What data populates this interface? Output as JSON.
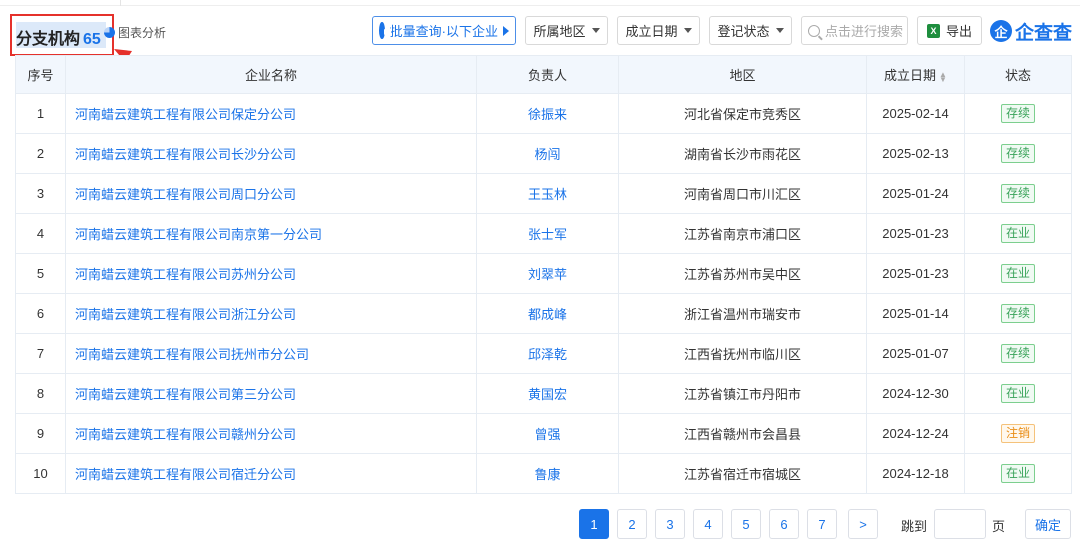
{
  "header": {
    "title": "分支机构",
    "count": "65",
    "chart_link": "图表分析",
    "batch_query": "批量查询·以下企业",
    "filters": {
      "region": "所属地区",
      "founded": "成立日期",
      "status": "登记状态"
    },
    "search_placeholder": "点击进行搜索",
    "export_label": "导出",
    "logo_text": "企查查",
    "logo_mark": "企"
  },
  "table": {
    "columns": [
      "序号",
      "企业名称",
      "负责人",
      "地区",
      "成立日期",
      "状态"
    ],
    "rows": [
      [
        "1",
        "河南蜡云建筑工程有限公司保定分公司",
        "徐振来",
        "河北省保定市竞秀区",
        "2025-02-14",
        "存续"
      ],
      [
        "2",
        "河南蜡云建筑工程有限公司长沙分公司",
        "杨闯",
        "湖南省长沙市雨花区",
        "2025-02-13",
        "存续"
      ],
      [
        "3",
        "河南蜡云建筑工程有限公司周口分公司",
        "王玉林",
        "河南省周口市川汇区",
        "2025-01-24",
        "存续"
      ],
      [
        "4",
        "河南蜡云建筑工程有限公司南京第一分公司",
        "张士军",
        "江苏省南京市浦口区",
        "2025-01-23",
        "在业"
      ],
      [
        "5",
        "河南蜡云建筑工程有限公司苏州分公司",
        "刘翠苹",
        "江苏省苏州市吴中区",
        "2025-01-23",
        "在业"
      ],
      [
        "6",
        "河南蜡云建筑工程有限公司浙江分公司",
        "都成峰",
        "浙江省温州市瑞安市",
        "2025-01-14",
        "存续"
      ],
      [
        "7",
        "河南蜡云建筑工程有限公司抚州市分公司",
        "邱泽乾",
        "江西省抚州市临川区",
        "2025-01-07",
        "存续"
      ],
      [
        "8",
        "河南蜡云建筑工程有限公司第三分公司",
        "黄国宏",
        "江苏省镇江市丹阳市",
        "2024-12-30",
        "在业"
      ],
      [
        "9",
        "河南蜡云建筑工程有限公司赣州分公司",
        "曾强",
        "江西省赣州市会昌县",
        "2024-12-24",
        "注销"
      ],
      [
        "10",
        "河南蜡云建筑工程有限公司宿迁分公司",
        "鲁康",
        "江苏省宿迁市宿城区",
        "2024-12-18",
        "在业"
      ]
    ]
  },
  "pagination": {
    "pages": [
      "1",
      "2",
      "3",
      "4",
      "5",
      "6",
      "7"
    ],
    "current": "1",
    "next": ">",
    "jump_label": "跳到",
    "page_unit": "页",
    "confirm": "确定"
  },
  "colors": {
    "accent": "#1a73e8",
    "highlight_border": "#e5312b",
    "status_active": "#3aa35a",
    "status_cancelled": "#e98d16"
  }
}
